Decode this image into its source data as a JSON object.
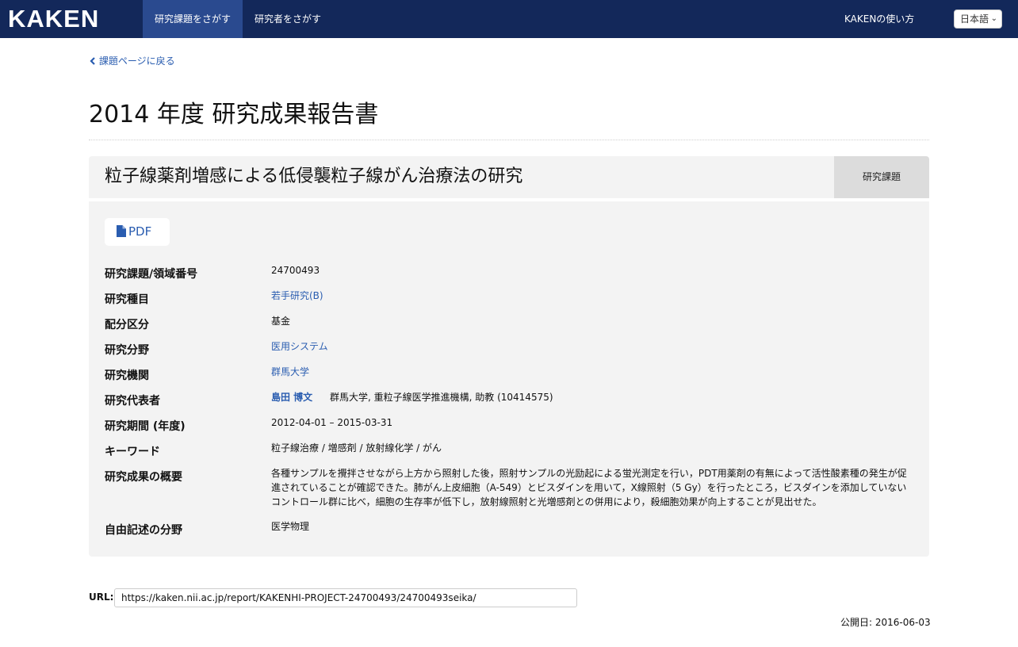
{
  "header": {
    "logo": "KAKEN",
    "nav": [
      {
        "label": "研究課題をさがす",
        "active": true
      },
      {
        "label": "研究者をさがす",
        "active": false
      }
    ],
    "help_link": "KAKENの使い方",
    "language": "日本語"
  },
  "back_link": "課題ページに戻る",
  "page_title": "2014 年度 研究成果報告書",
  "project": {
    "title": "粒子線薬剤増感による低侵襲粒子線がん治療法の研究",
    "tag": "研究課題",
    "pdf_label": "PDF",
    "fields": {
      "project_number": {
        "label": "研究課題/領域番号",
        "value": "24700493"
      },
      "category": {
        "label": "研究種目",
        "value": "若手研究(B)"
      },
      "allocation": {
        "label": "配分区分",
        "value": "基金"
      },
      "field": {
        "label": "研究分野",
        "value": "医用システム"
      },
      "institution": {
        "label": "研究機関",
        "value": "群馬大学"
      },
      "representative": {
        "label": "研究代表者",
        "name": "島田 博文",
        "affiliation": "群馬大学, 重粒子線医学推進機構, 助教 (10414575)"
      },
      "period": {
        "label": "研究期間 (年度)",
        "value": "2012-04-01 – 2015-03-31"
      },
      "keywords": {
        "label": "キーワード",
        "value": "粒子線治療 / 増感剤 / 放射線化学 / がん"
      },
      "summary": {
        "label": "研究成果の概要",
        "value": "各種サンプルを攪拌させながら上方から照射した後，照射サンプルの光励起による蛍光測定を行い，PDT用薬剤の有無によって活性酸素種の発生が促進されていることが確認できた。肺がん上皮細胞（A-549）とビスダインを用いて，X線照射（5 Gy）を行ったところ，ビスダインを添加していないコントロール群に比べ，細胞の生存率が低下し，放射線照射と光増感剤との併用により，殺細胞効果が向上することが見出せた。"
      },
      "free_field": {
        "label": "自由記述の分野",
        "value": "医学物理"
      }
    }
  },
  "url": {
    "label": "URL:",
    "value": "https://kaken.nii.ac.jp/report/KAKENHI-PROJECT-24700493/24700493seika/"
  },
  "published": "公開日: 2016-06-03"
}
